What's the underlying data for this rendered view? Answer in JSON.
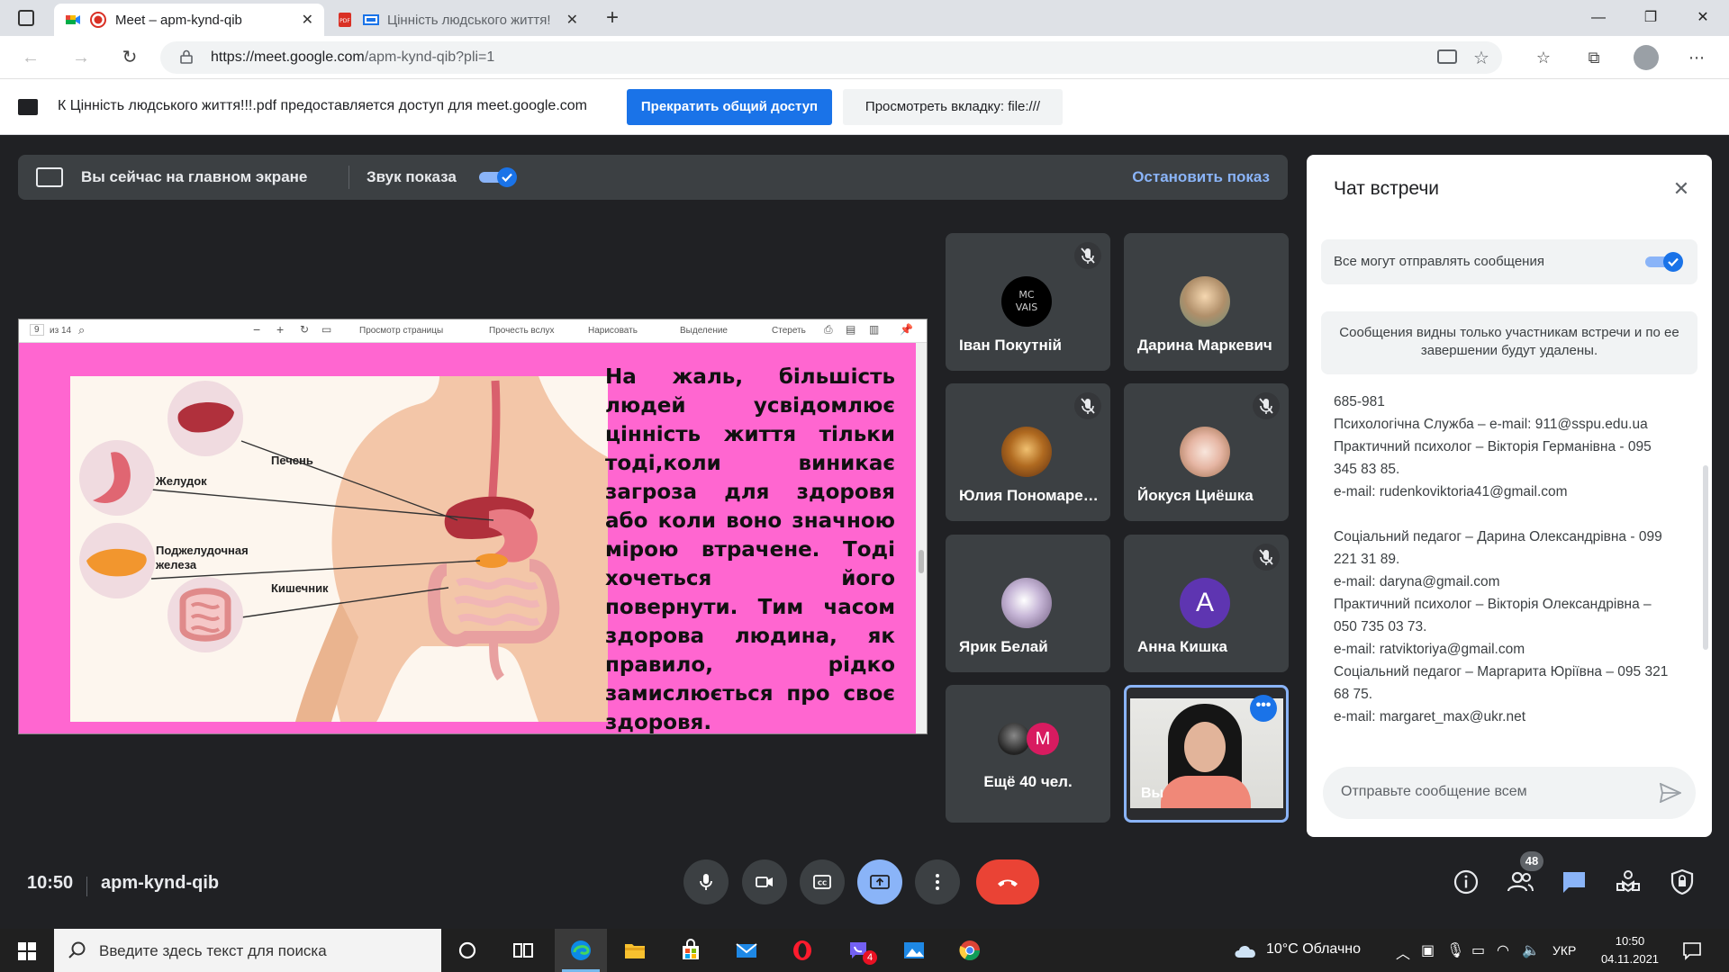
{
  "browser": {
    "tabs": [
      {
        "label": "Meet – apm-kynd-qib",
        "active": true
      },
      {
        "label": "Цінність людського життя!",
        "active": false
      }
    ],
    "url_host": "https://meet.google.com",
    "url_path": "/apm-kynd-qib?pli=1"
  },
  "share_notice": {
    "message": "К Цінність людського життя!!!.pdf предоставляется доступ для meet.google.com",
    "stop_label": "Прекратить общий доступ",
    "view_label": "Просмотреть вкладку: file:///"
  },
  "presenting": {
    "main_text": "Вы сейчас на главном экране",
    "audio_label": "Звук показа",
    "stop_label": "Остановить показ"
  },
  "pdf_toolbar": {
    "page": "9",
    "of": "из 14",
    "items": [
      "Просмотр страницы",
      "Прочесть вслух",
      "Нарисовать",
      "Выделение",
      "Стереть"
    ]
  },
  "slide": {
    "labels": [
      "Печень",
      "Желудок",
      "Поджелудочная железа",
      "Кишечник"
    ],
    "text": "На жаль, більшість людей усвідомлює цінність життя тільки тоді,коли виникає загроза для здоровя або коли воно значною мірою втрачене. Тоді хочеться його повернути. Тим часом здорова людина, як правило, рідко замислюється про своє здоровя."
  },
  "participants": [
    {
      "name": "Іван Покутній",
      "muted": true,
      "avatar_text": "MC\nVAIS"
    },
    {
      "name": "Дарина Маркевич",
      "muted": false
    },
    {
      "name": "Юлия Пономаренко",
      "muted": true
    },
    {
      "name": "Йокуся Циёшка",
      "muted": true
    },
    {
      "name": "Ярик Белай",
      "muted": false
    },
    {
      "name": "Анна Кишка",
      "muted": true,
      "letter": "A"
    },
    {
      "name": "Ещё 40 чел.",
      "letter": "M"
    },
    {
      "name": "Вы"
    }
  ],
  "chat": {
    "title": "Чат встречи",
    "allow_label": "Все могут отправлять сообщения",
    "notice": "Сообщения видны только участникам встречи и по ее завершении будут удалены.",
    "messages": [
      "685-981",
      "Психологічна Служба – e-mail: 911@sspu.edu.ua",
      "Практичний психолог – Вікторія Германівна - 095 345 83 85.",
      "e-mail: rudenkoviktoria41@gmail.com",
      "Соціальний педагог – Дарина Олександрівна - 099 221 31 89.",
      "e-mail: daryna@gmail.com",
      "Практичний психолог – Вікторія Олександрівна – 050 735 03 73.",
      "e-mail: ratviktoriya@gmail.com",
      "Соціальний педагог – Маргарита Юріївна – 095 321 68 75.",
      "e-mail: margaret_max@ukr.net"
    ],
    "input_placeholder": "Отправьте сообщение всем"
  },
  "meeting": {
    "time": "10:50",
    "code": "apm-kynd-qib",
    "participants_count": "48"
  },
  "taskbar": {
    "search_placeholder": "Введите здесь текст для поиска",
    "weather": "10°C Облачно",
    "lang": "УКР",
    "time": "10:50",
    "date": "04.11.2021",
    "viber_badge": "4"
  }
}
